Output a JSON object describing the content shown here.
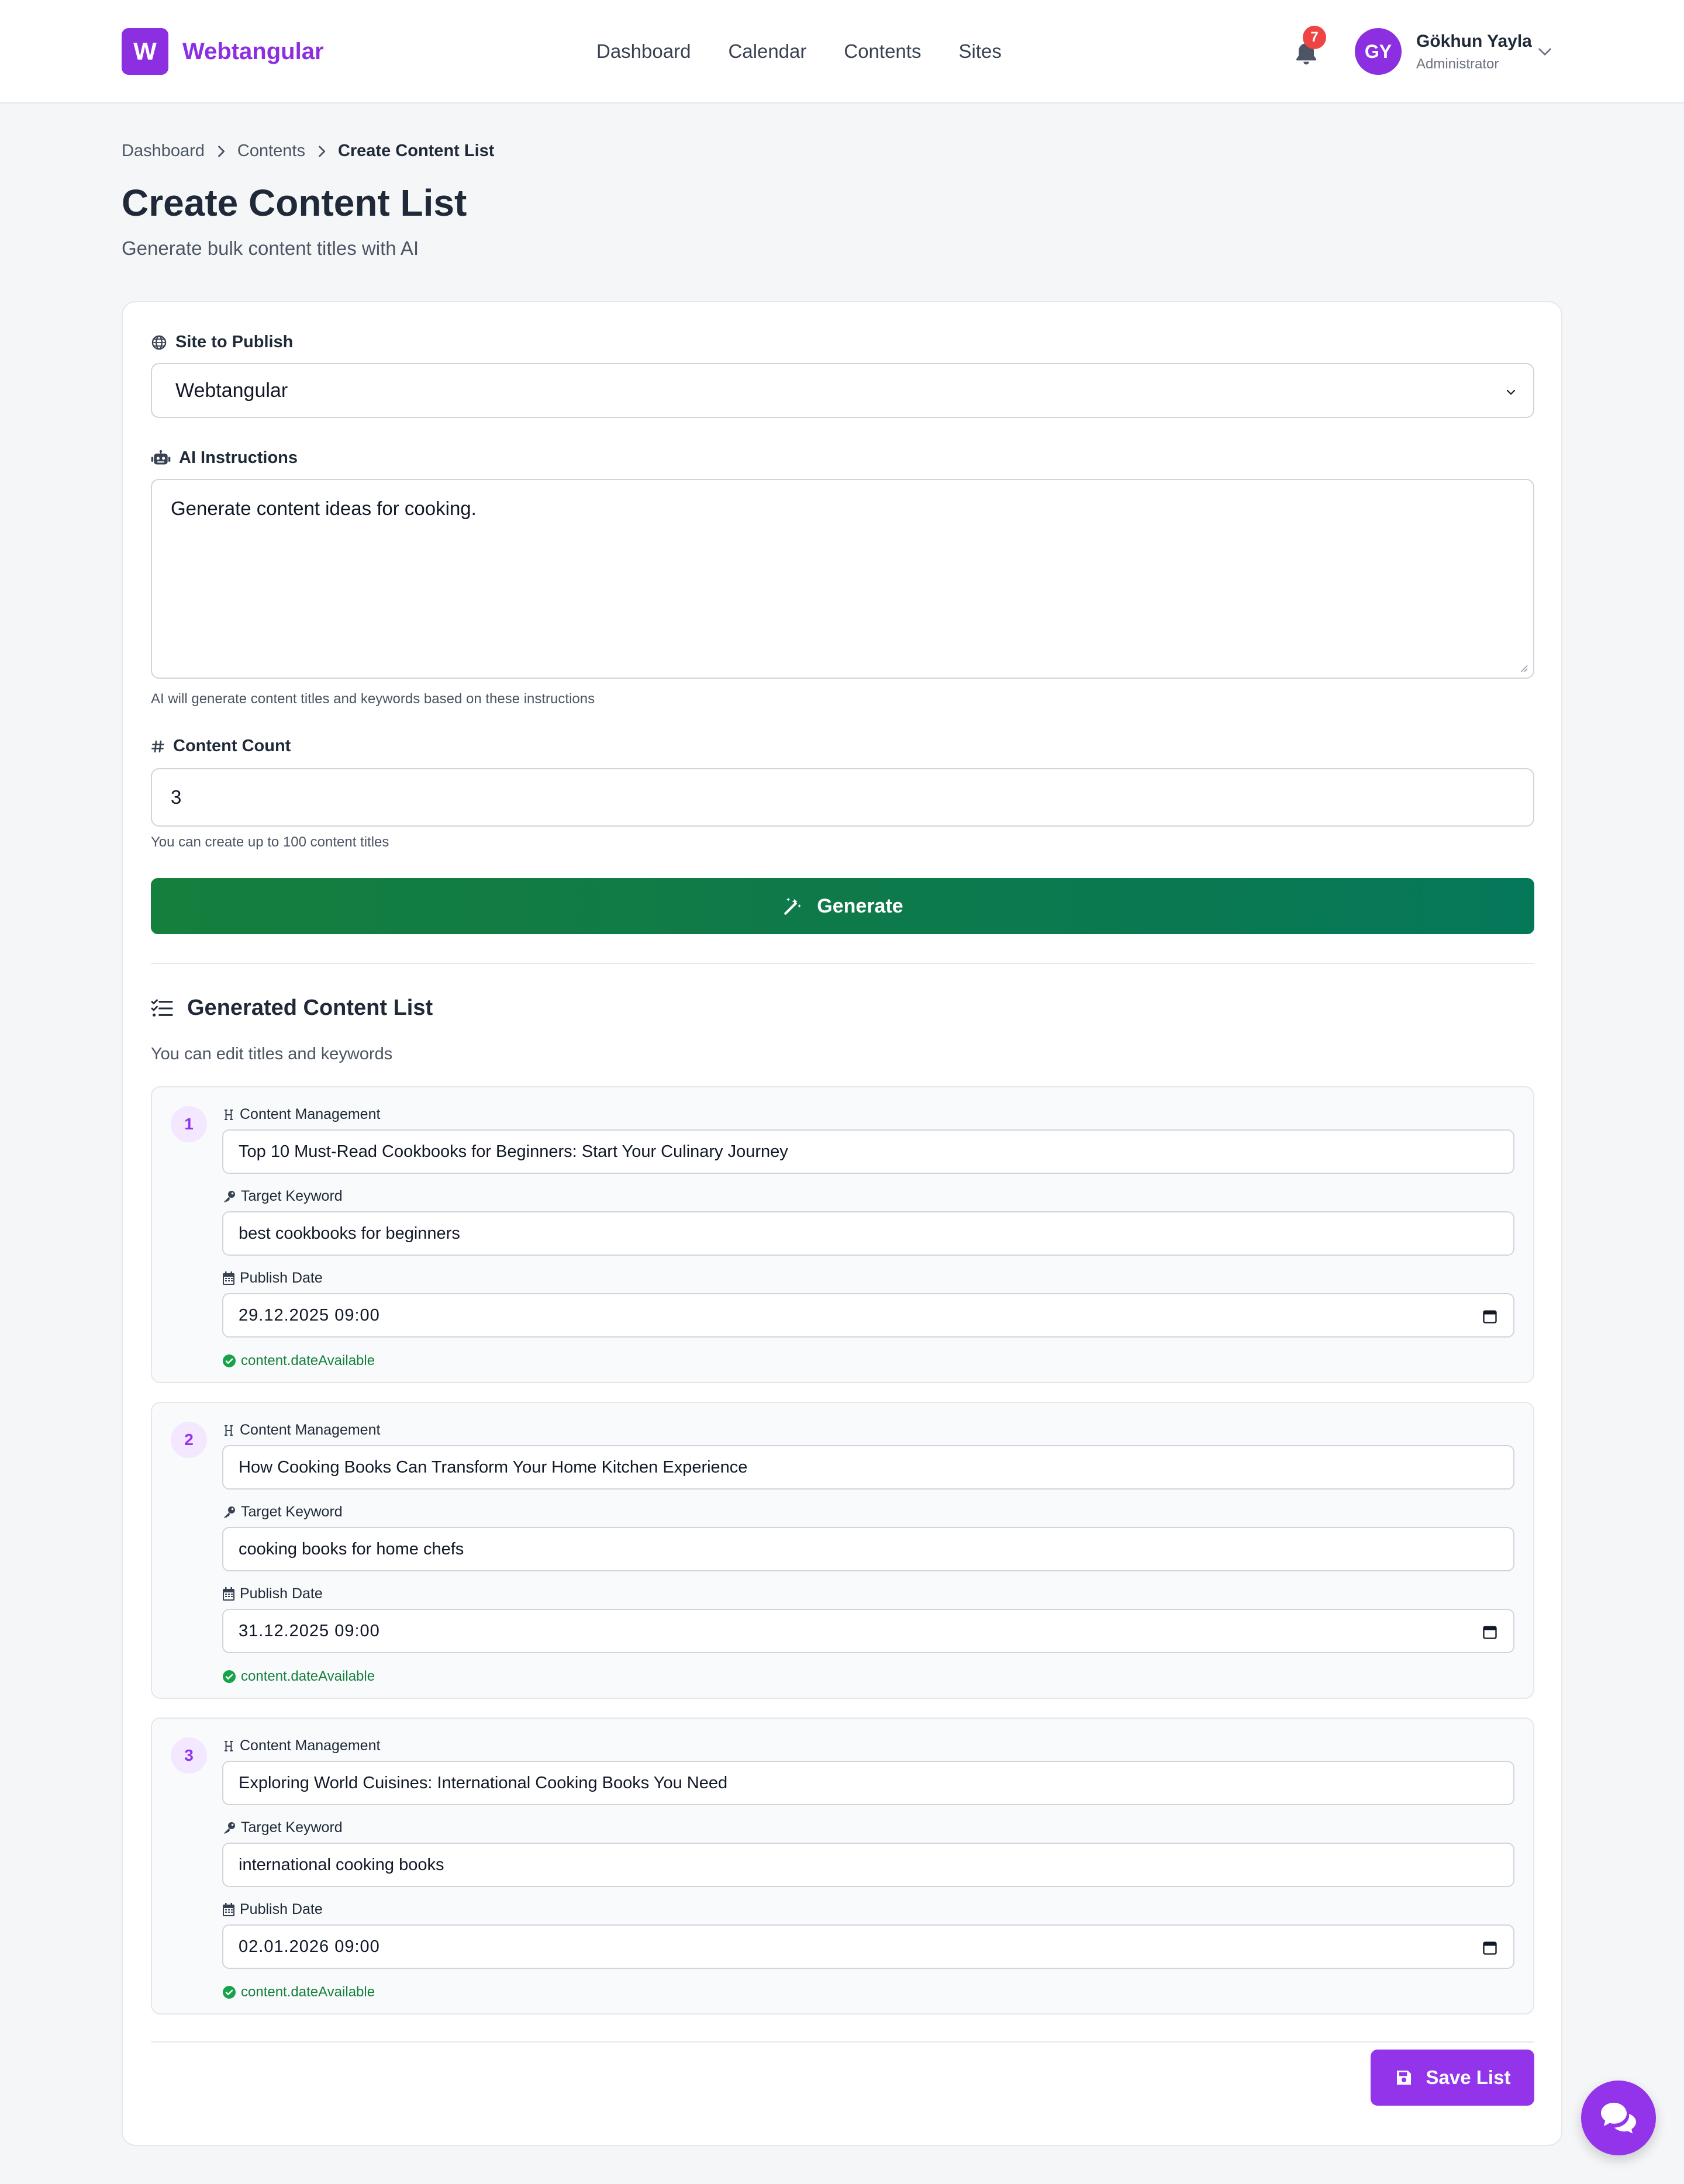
{
  "brand": {
    "letter": "W",
    "name": "Webtangular",
    "color": "#8b2fe0"
  },
  "nav": {
    "items": [
      "Dashboard",
      "Calendar",
      "Contents",
      "Sites"
    ]
  },
  "notifications": {
    "count": "7"
  },
  "user": {
    "initials": "GY",
    "name": "Gökhun Yayla",
    "role": "Administrator"
  },
  "breadcrumb": [
    "Dashboard",
    "Contents",
    "Create Content List"
  ],
  "page": {
    "title": "Create Content List",
    "subtitle": "Generate bulk content titles with AI"
  },
  "form": {
    "site_label": "Site to Publish",
    "site_value": "Webtangular",
    "instructions_label": "AI Instructions",
    "instructions_value": "Generate content ideas for cooking.",
    "instructions_hint": "AI will generate content titles and keywords based on these instructions",
    "count_label": "Content Count",
    "count_value": "3",
    "count_hint": "You can create up to 100 content titles",
    "generate_label": "Generate"
  },
  "generated": {
    "title": "Generated Content List",
    "subtitle": "You can edit titles and keywords",
    "title_label": "Content Management",
    "keyword_label": "Target Keyword",
    "date_label": "Publish Date",
    "status_text": "content.dateAvailable",
    "items": [
      {
        "num": "1",
        "title": "Top 10 Must-Read Cookbooks for Beginners: Start Your Culinary Journey",
        "keyword": "best cookbooks for beginners",
        "date": "29.12.2025 09:00"
      },
      {
        "num": "2",
        "title": "How Cooking Books Can Transform Your Home Kitchen Experience",
        "keyword": "cooking books for home chefs",
        "date": "31.12.2025 09:00"
      },
      {
        "num": "3",
        "title": "Exploring World Cuisines: International Cooking Books You Need",
        "keyword": "international cooking books",
        "date": "02.01.2026 09:00"
      }
    ]
  },
  "save_label": "Save List",
  "colors": {
    "accent": "#9333ea",
    "success": "#15803d",
    "generate": "#0e7a4a",
    "badge": "#ef4444"
  },
  "icons": [
    "bell-icon",
    "chevron-down-icon",
    "globe-icon",
    "robot-icon",
    "hash-icon",
    "magic-wand-icon",
    "list-check-icon",
    "heading-icon",
    "key-icon",
    "calendar-icon",
    "check-circle-icon",
    "save-icon",
    "chat-icon"
  ]
}
